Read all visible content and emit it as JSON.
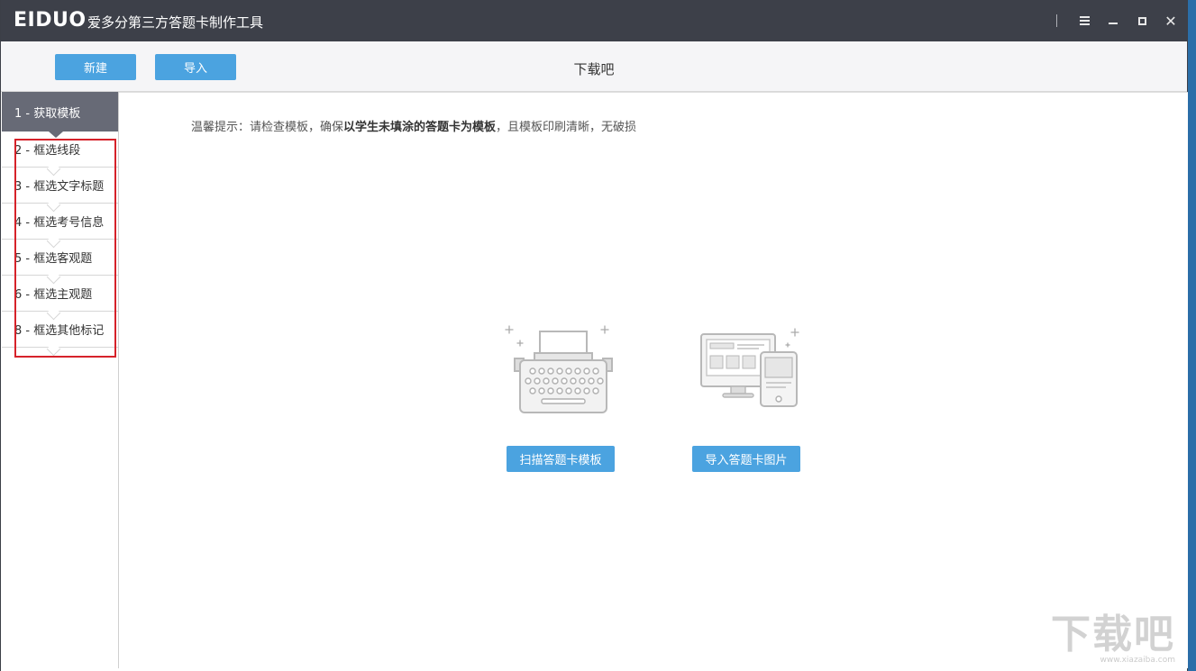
{
  "titlebar": {
    "logo": "EIDUO",
    "title": "爱多分第三方答题卡制作工具"
  },
  "toolbar": {
    "new_label": "新建",
    "import_label": "导入",
    "doc_title": "下载吧"
  },
  "sidebar": {
    "steps": [
      {
        "label": "1 - 获取模板"
      },
      {
        "label": "2 - 框选线段"
      },
      {
        "label": "3 - 框选文字标题"
      },
      {
        "label": "4 - 框选考号信息"
      },
      {
        "label": "5 - 框选客观题"
      },
      {
        "label": "6 - 框选主观题"
      },
      {
        "label": "8 - 框选其他标记"
      }
    ]
  },
  "main": {
    "tip_prefix": "温馨提示：请检查模板，确保",
    "tip_bold": "以学生未填涂的答题卡为模板",
    "tip_suffix": "，且模板印刷清晰，无破损",
    "scan_label": "扫描答题卡模板",
    "import_image_label": "导入答题卡图片"
  },
  "watermark": {
    "text": "下载吧",
    "url": "www.xiazaiba.com"
  },
  "colors": {
    "accent": "#4ba3e0",
    "titlebar": "#3d4049",
    "active_step": "#676a76",
    "highlight": "#d6222a"
  }
}
